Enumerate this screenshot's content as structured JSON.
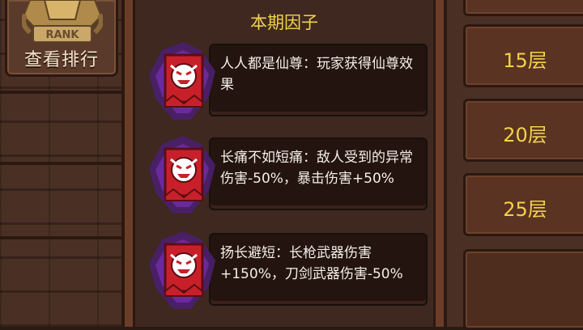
{
  "rank": {
    "emblem_text": "RANK",
    "label": "查看排行"
  },
  "panel": {
    "title": "本期因子"
  },
  "factors": [
    {
      "icon": "demon-banner-icon",
      "text": "人人都是仙尊：玩家获得仙尊效果"
    },
    {
      "icon": "demon-banner-icon",
      "text": "长痛不如短痛：敌人受到的异常伤害-50%，暴击伤害+50%"
    },
    {
      "icon": "demon-banner-icon",
      "text": "扬长避短：长枪武器伤害+150%，刀剑武器伤害-50%"
    }
  ],
  "floors": [
    "15层",
    "20层",
    "25层"
  ],
  "colors": {
    "gold_text": "#f2d34a",
    "panel_bg": "#3e2820",
    "banner_red": "#c8202a",
    "aura_purple": "#6a2a9c"
  }
}
